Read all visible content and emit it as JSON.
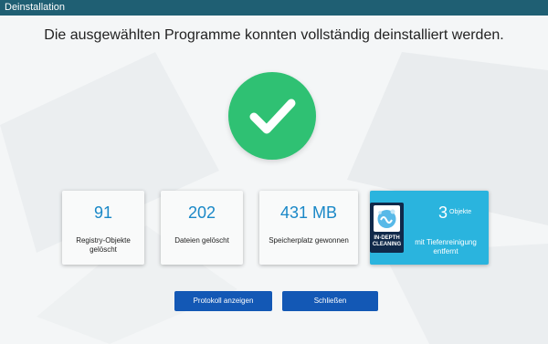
{
  "window": {
    "title": "Deinstallation"
  },
  "heading": "Die ausgewählten Programme konnten vollständig deinstalliert werden.",
  "stats": [
    {
      "value": "91",
      "label": "Registry-Objekte gelöscht"
    },
    {
      "value": "202",
      "label": "Dateien gelöscht"
    },
    {
      "value": "431 MB",
      "label": "Speicherplatz gewonnen"
    }
  ],
  "deep_clean": {
    "badge_text": "IN-DEPTH CLEANING",
    "value": "3",
    "unit": "Objekte",
    "label": "mit Tiefenreinigung entfernt"
  },
  "buttons": {
    "log": "Protokoll anzeigen",
    "close": "Schließen"
  },
  "colors": {
    "titlebar": "#1f5f73",
    "success": "#2fc173",
    "accent": "#1a88c7",
    "highlight_card": "#2ab4de",
    "button": "#1358b5"
  },
  "icons": {
    "status": "checkmark-icon",
    "badge": "deep-cleaning-badge-icon"
  }
}
